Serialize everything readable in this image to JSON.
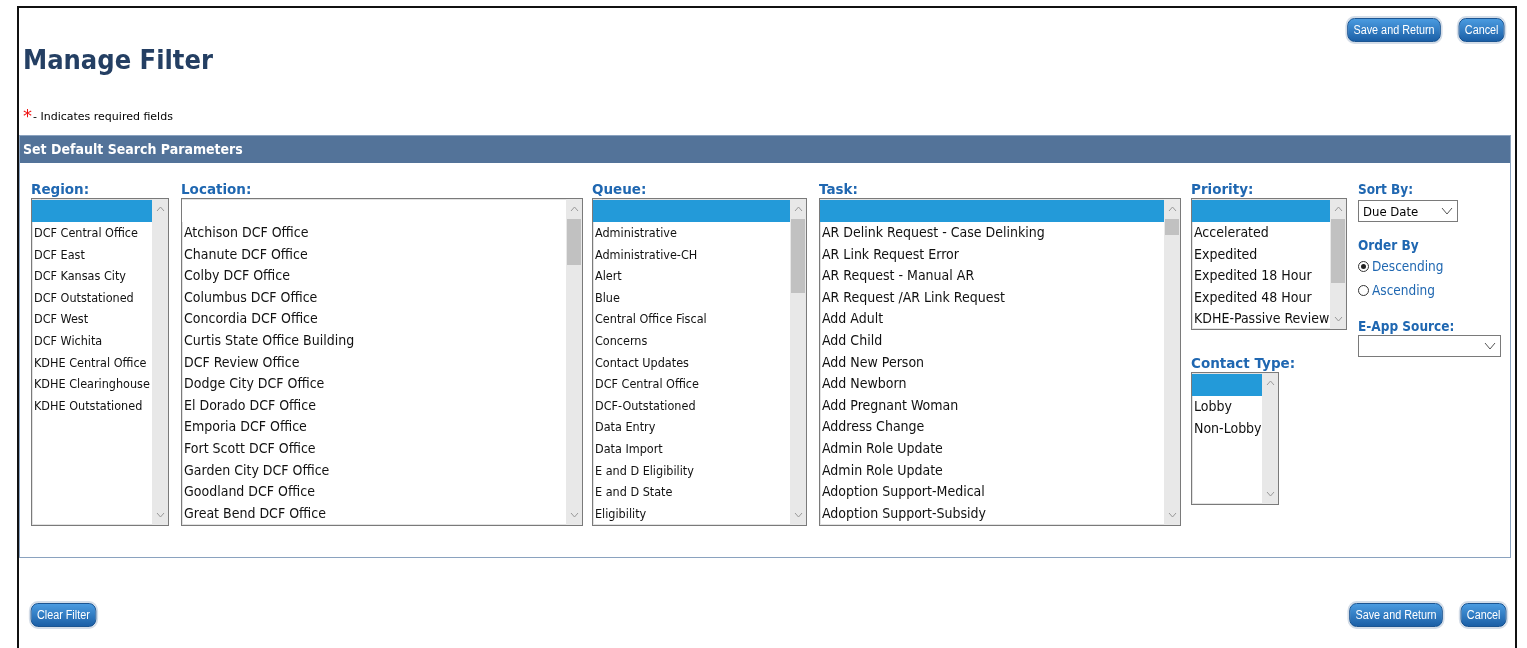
{
  "top_buttons": [
    {
      "label": "Save and Return"
    },
    {
      "label": "Cancel"
    }
  ],
  "title": "Manage Filter",
  "required_note": {
    "marker": "*",
    "text": "- Indicates required fields"
  },
  "section": {
    "title": "Set Default Search Parameters"
  },
  "listboxes": [
    {
      "label": "Region:",
      "blank_selected": true,
      "items": [
        {
          "text": "DCF Central Office",
          "selected": false
        },
        {
          "text": "DCF East",
          "selected": false
        },
        {
          "text": "DCF Kansas City",
          "selected": false
        },
        {
          "text": "DCF Outstationed",
          "selected": false
        },
        {
          "text": "DCF West",
          "selected": false
        },
        {
          "text": "DCF Wichita",
          "selected": false
        },
        {
          "text": "KDHE Central Office",
          "selected": false
        },
        {
          "text": "KDHE Clearinghouse",
          "selected": false
        },
        {
          "text": "KDHE Outstationed",
          "selected": false
        }
      ]
    },
    {
      "label": "Location:",
      "blank_selected": false,
      "items": [
        {
          "text": "Atchison DCF Office",
          "selected": false
        },
        {
          "text": "Chanute DCF Office",
          "selected": false
        },
        {
          "text": "Colby DCF Office",
          "selected": false
        },
        {
          "text": "Columbus DCF Office",
          "selected": false
        },
        {
          "text": "Concordia DCF Office",
          "selected": false
        },
        {
          "text": "Curtis State Office Building",
          "selected": false
        },
        {
          "text": "DCF Review Office",
          "selected": false
        },
        {
          "text": "Dodge City DCF Office",
          "selected": false
        },
        {
          "text": "El Dorado DCF Office",
          "selected": false
        },
        {
          "text": "Emporia DCF Office",
          "selected": false
        },
        {
          "text": "Fort Scott DCF Office",
          "selected": false
        },
        {
          "text": "Garden City DCF Office",
          "selected": false
        },
        {
          "text": "Goodland DCF Office",
          "selected": false
        },
        {
          "text": "Great Bend DCF Office",
          "selected": false
        }
      ]
    },
    {
      "label": "Queue:",
      "blank_selected": true,
      "items": [
        {
          "text": "Administrative",
          "selected": false
        },
        {
          "text": "Administrative-CH",
          "selected": false
        },
        {
          "text": "Alert",
          "selected": false
        },
        {
          "text": "Blue",
          "selected": false
        },
        {
          "text": "Central Office Fiscal",
          "selected": false
        },
        {
          "text": "Concerns",
          "selected": false
        },
        {
          "text": "Contact Updates",
          "selected": false
        },
        {
          "text": "DCF Central Office",
          "selected": false
        },
        {
          "text": "DCF-Outstationed",
          "selected": false
        },
        {
          "text": "Data Entry",
          "selected": false
        },
        {
          "text": "Data Import",
          "selected": false
        },
        {
          "text": "E and D Eligibility",
          "selected": false
        },
        {
          "text": "E and D State",
          "selected": false
        },
        {
          "text": "Eligibility",
          "selected": false
        }
      ]
    },
    {
      "label": "Task:",
      "blank_selected": true,
      "items": [
        {
          "text": "AR Delink Request - Case Delinking",
          "selected": false
        },
        {
          "text": "AR Link Request Error",
          "selected": false
        },
        {
          "text": "AR Request - Manual AR",
          "selected": false
        },
        {
          "text": "AR Request /AR Link Request",
          "selected": false
        },
        {
          "text": "Add Adult",
          "selected": false
        },
        {
          "text": "Add Child",
          "selected": false
        },
        {
          "text": "Add New Person",
          "selected": false
        },
        {
          "text": "Add Newborn",
          "selected": false
        },
        {
          "text": "Add Pregnant Woman",
          "selected": false
        },
        {
          "text": "Address Change",
          "selected": false
        },
        {
          "text": "Admin Role Update",
          "selected": false
        },
        {
          "text": "Admin Role Update",
          "selected": false
        },
        {
          "text": "Adoption Support-Medical",
          "selected": false
        },
        {
          "text": "Adoption Support-Subsidy",
          "selected": false
        }
      ]
    },
    {
      "label": "Priority:",
      "blank_selected": true,
      "items": [
        {
          "text": "Accelerated",
          "selected": false
        },
        {
          "text": "Expedited",
          "selected": false
        },
        {
          "text": "Expedited 18 Hour",
          "selected": false
        },
        {
          "text": "Expedited 48 Hour",
          "selected": false
        },
        {
          "text": "KDHE-Passive Review",
          "selected": false
        }
      ]
    },
    {
      "label": "Contact Type:",
      "blank_selected": true,
      "items": [
        {
          "text": "Lobby",
          "selected": false
        },
        {
          "text": "Non-Lobby",
          "selected": false
        }
      ]
    }
  ],
  "sort_by": {
    "label": "Sort By:",
    "value": "Due Date"
  },
  "order_by": {
    "label": "Order By",
    "options": [
      {
        "label": "Descending",
        "selected": true
      },
      {
        "label": "Ascending",
        "selected": false
      }
    ]
  },
  "eapp_source": {
    "label": "E-App Source:"
  },
  "bottom_left_buttons": [
    {
      "label": "Clear Filter"
    }
  ],
  "bottom_right_buttons": [
    {
      "label": "Save and Return"
    },
    {
      "label": "Cancel"
    }
  ]
}
